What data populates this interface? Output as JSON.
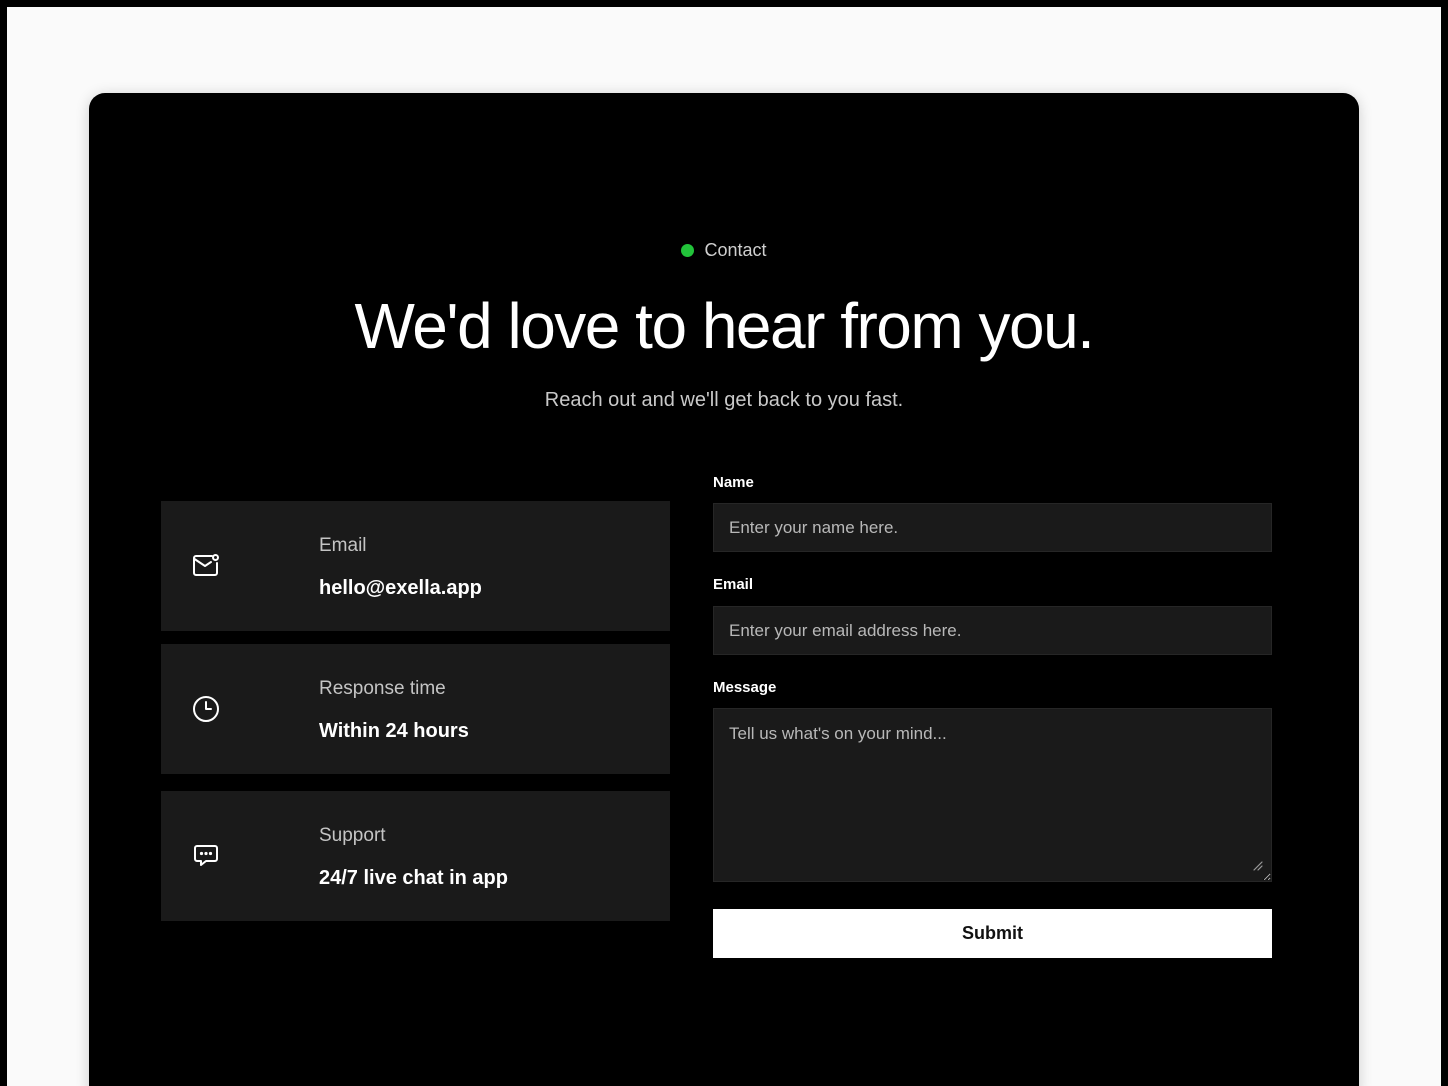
{
  "section": {
    "eyebrow": "Contact",
    "eyebrow_dot_color": "#22c33a",
    "title": "We'd love to hear from you.",
    "subtitle": "Reach out and we'll get back to you fast."
  },
  "info_cards": [
    {
      "icon": "mail-icon",
      "label": "Email",
      "value": "hello@exella.app"
    },
    {
      "icon": "clock-icon",
      "label": "Response time",
      "value": "Within 24 hours"
    },
    {
      "icon": "chat-bubble-icon",
      "label": "Support",
      "value": "24/7 live chat in app"
    }
  ],
  "form": {
    "name_label": "Name",
    "name_placeholder": "Enter your name here.",
    "email_label": "Email",
    "email_placeholder": "Enter your email address here.",
    "message_label": "Message",
    "message_placeholder": "Tell us what's on your mind...",
    "submit_label": "Submit"
  }
}
